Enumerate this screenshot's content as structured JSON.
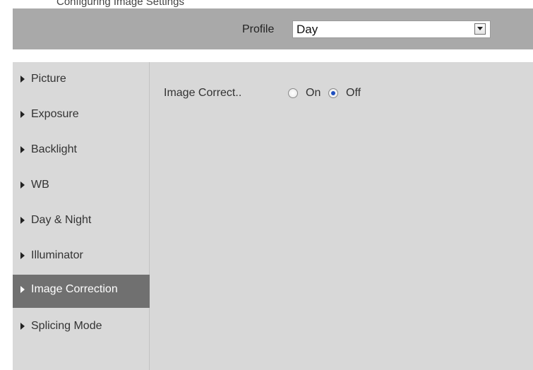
{
  "top_fragment": "Configuring Image Settings",
  "header": {
    "profile_label": "Profile",
    "profile_value": "Day",
    "dropdown_icon": "chevron-down-icon"
  },
  "sidebar": {
    "items": [
      {
        "label": "Picture",
        "active": false
      },
      {
        "label": "Exposure",
        "active": false
      },
      {
        "label": "Backlight",
        "active": false
      },
      {
        "label": "WB",
        "active": false
      },
      {
        "label": "Day & Night",
        "active": false
      },
      {
        "label": "Illuminator",
        "active": false
      },
      {
        "label": "Image Correction",
        "active": true
      },
      {
        "label": "Splicing Mode",
        "active": false
      }
    ]
  },
  "content": {
    "image_correction_label": "Image Correct..",
    "option_on": "On",
    "option_off": "Off",
    "selected": "Off"
  },
  "colors": {
    "header_bg": "#a9a9a9",
    "sidebar_bg": "#d9d9d9",
    "active_bg": "#707070",
    "radio_dot": "#1f4fbf"
  }
}
